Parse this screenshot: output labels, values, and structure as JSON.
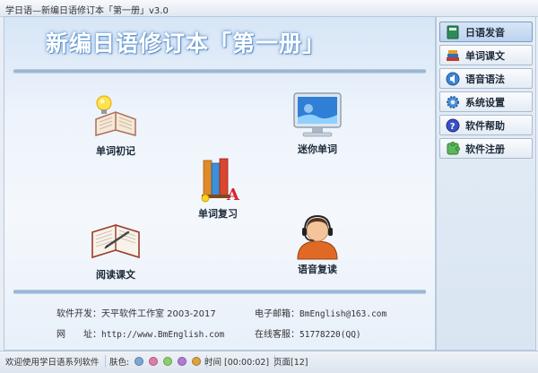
{
  "window": {
    "title": "学日语—新编日语修订本「第一册」v3.0"
  },
  "banner": {
    "title": "新编日语修订本「第一册」"
  },
  "features": [
    {
      "label": "单词初记",
      "icon": "lightbulb-book-icon"
    },
    {
      "label": "迷你单词",
      "icon": "monitor-icon"
    },
    {
      "label": "单词复习",
      "icon": "books-icon"
    },
    {
      "label": "阅读课文",
      "icon": "open-book-icon"
    },
    {
      "label": "语音复读",
      "icon": "headset-user-icon"
    }
  ],
  "info": {
    "developer_label": "软件开发：",
    "developer_value": "天平软件工作室 2003-2017",
    "email_label": "电子邮箱：",
    "email_value": "BmEnglish@163.com",
    "website_label": "网　　址：",
    "website_value": "http://www.BmEnglish.com",
    "support_label": "在线客服：",
    "support_value": "51778220(QQ)"
  },
  "sidebar": {
    "items": [
      {
        "label": "日语发音",
        "icon": "japanese-book-icon"
      },
      {
        "label": "单词课文",
        "icon": "book-stack-icon"
      },
      {
        "label": "语音语法",
        "icon": "speaker-icon"
      },
      {
        "label": "系统设置",
        "icon": "gear-icon"
      },
      {
        "label": "软件帮助",
        "icon": "help-icon"
      },
      {
        "label": "软件注册",
        "icon": "puzzle-icon"
      }
    ]
  },
  "status": {
    "welcome": "欢迎使用学日语系列软件",
    "skin_label": "肤色:",
    "skin_colors": [
      "#7aa7d8",
      "#e07aa8",
      "#8ccf6a",
      "#b07ad8",
      "#e0a040"
    ],
    "time_label": "时间",
    "time_value": "[00:00:02]",
    "page_label": "页面",
    "page_value": "[12]"
  }
}
